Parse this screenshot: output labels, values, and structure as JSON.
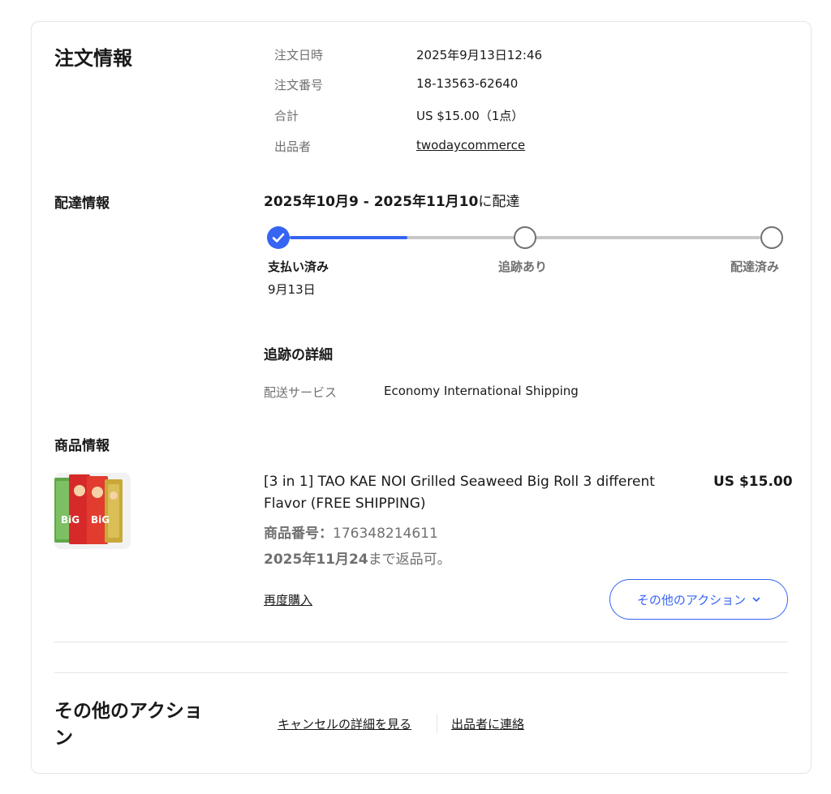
{
  "order_info": {
    "title": "注文情報",
    "rows": [
      {
        "label": "注文日時",
        "value": "2025年9月13日12:46"
      },
      {
        "label": "注文番号",
        "value": "18-13563-62640"
      },
      {
        "label": "合計",
        "value": "US $15.00（1点）"
      },
      {
        "label": "出品者",
        "value": "twodaycommerce"
      }
    ]
  },
  "delivery": {
    "title": "配達情報",
    "range_bold": "2025年10月9 - 2025年11月10",
    "range_suffix": "に配達",
    "steps": [
      {
        "label": "支払い済み",
        "date": "9月13日",
        "status": "done"
      },
      {
        "label": "追跡あり",
        "date": "",
        "status": "pending"
      },
      {
        "label": "配達済み",
        "date": "",
        "status": "pending"
      }
    ],
    "progress_fraction": 0.25,
    "tracking_title": "追跡の詳細",
    "service_label": "配送サービス",
    "service_value": "Economy International Shipping"
  },
  "item": {
    "section_title": "商品情報",
    "name_line1": "[3 in 1] TAO KAE NOI Grilled Seaweed Big Roll 3 different",
    "name_line2": "Flavor (FREE SHIPPING)",
    "price": "US $15.00",
    "number_label": "商品番号：",
    "number_value": "176348214611",
    "return_date": "2025年11月24",
    "return_suffix": "まで返品可。",
    "rebuy_label": "再度購入",
    "more_actions_label": "その他のアクション",
    "thumb_text": "BiG"
  },
  "other_actions": {
    "title_line1": "その他のアクショ",
    "title_line2": "ン",
    "cancel_details": "キャンセルの詳細を見る",
    "contact_seller": "出品者に連絡"
  },
  "colors": {
    "accent": "#3665f3",
    "muted": "#707070",
    "divider": "#e5e5e5"
  }
}
